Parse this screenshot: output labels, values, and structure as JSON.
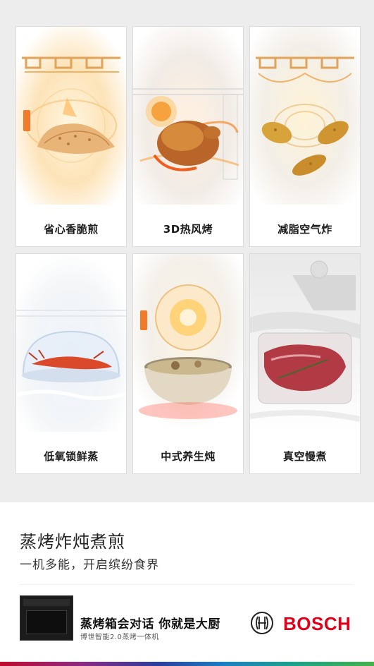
{
  "features": [
    {
      "label": "省心香脆煎",
      "icon": "flatbread-pan-fry-image"
    },
    {
      "label": "3D热风烤",
      "icon": "roast-chicken-image"
    },
    {
      "label": "减脂空气炸",
      "icon": "fried-chicken-wings-image"
    },
    {
      "label": "低氧锁鲜蒸",
      "icon": "steamed-lobster-image"
    },
    {
      "label": "中式养生炖",
      "icon": "stew-pot-image"
    },
    {
      "label": "真空慢煮",
      "icon": "vacuum-sealed-steak-image"
    }
  ],
  "headline": "蒸烤炸炖煮煎",
  "subline": "一机多能，开启缤纷食界",
  "product": {
    "slogan": "蒸烤箱会对话 你就是大厨",
    "name": "博世智能2.0蒸烤一体机"
  },
  "brand": {
    "name": "BOSCH",
    "color": "#e2001a"
  }
}
